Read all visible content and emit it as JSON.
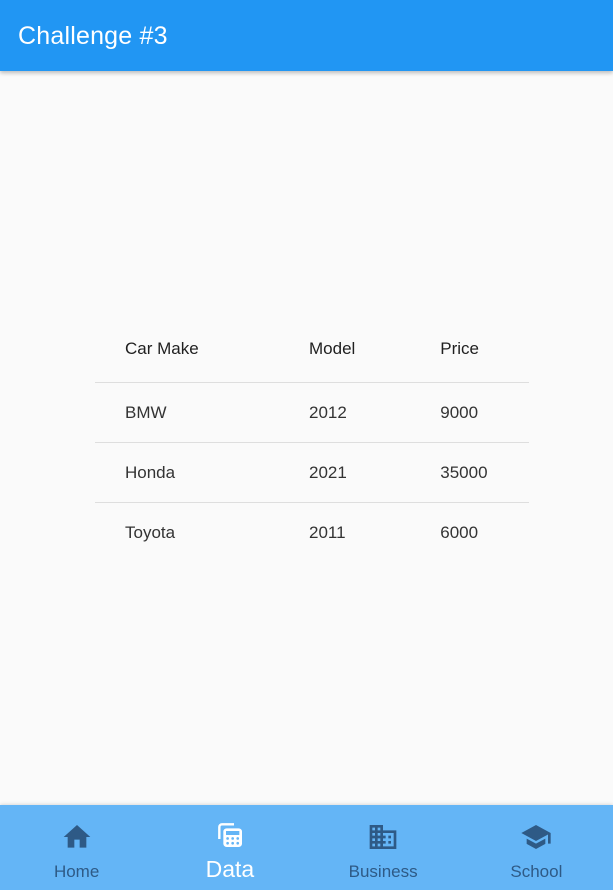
{
  "app_bar": {
    "title": "Challenge #3"
  },
  "table": {
    "headers": [
      "Car Make",
      "Model",
      "Price"
    ],
    "rows": [
      [
        "BMW",
        "2012",
        "9000"
      ],
      [
        "Honda",
        "2021",
        "35000"
      ],
      [
        "Toyota",
        "2011",
        "6000"
      ]
    ]
  },
  "bottom_nav": {
    "items": [
      {
        "label": "Home",
        "icon": "home-icon",
        "active": false
      },
      {
        "label": "Data",
        "icon": "data-icon",
        "active": true
      },
      {
        "label": "Business",
        "icon": "business-icon",
        "active": false
      },
      {
        "label": "School",
        "icon": "school-icon",
        "active": false
      }
    ]
  },
  "colors": {
    "app_bar": "#2196f3",
    "bottom_nav": "#64b5f6",
    "nav_inactive": "#2e5a86",
    "nav_active": "#ffffff",
    "background": "#fafafa"
  }
}
